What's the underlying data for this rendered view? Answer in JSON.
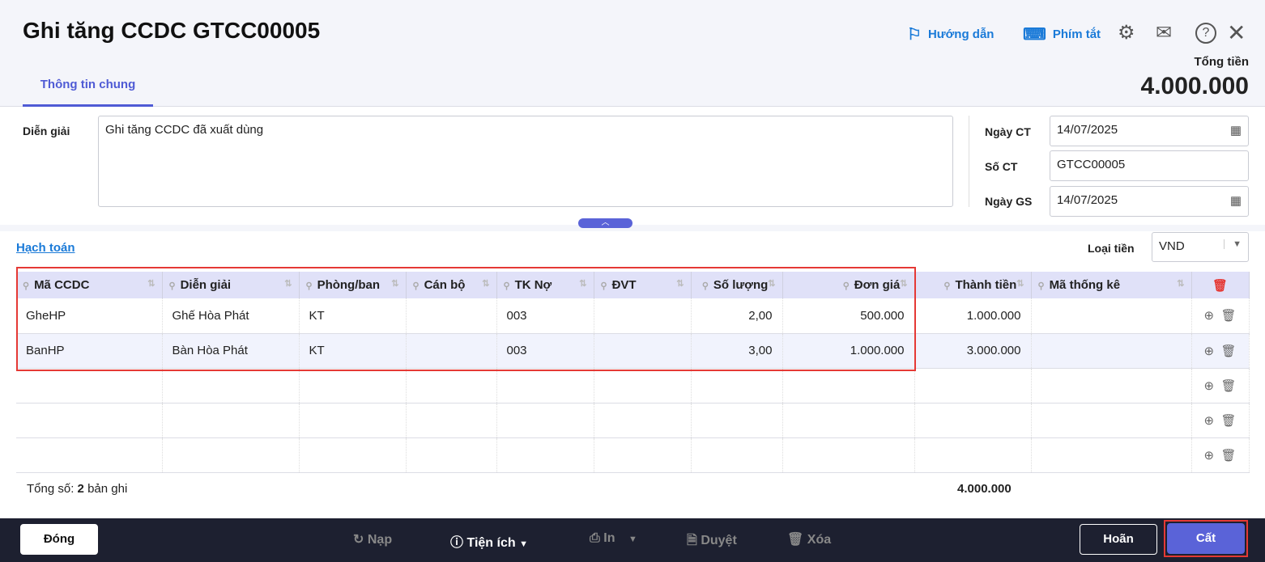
{
  "header": {
    "title": "Ghi tăng CCDC GTCC00005",
    "guide": "Hướng dẫn",
    "shortcuts": "Phím tắt",
    "total_label": "Tổng tiền",
    "total_value": "4.000.000"
  },
  "tabs": [
    {
      "label": "Thông tin chung",
      "active": true
    }
  ],
  "form": {
    "description_label": "Diễn giải",
    "description": "Ghi tăng CCDC đã xuất dùng",
    "date_ct_label": "Ngày CT",
    "date_ct": "14/07/2025",
    "so_ct_label": "Số CT",
    "so_ct": "GTCC00005",
    "date_gs_label": "Ngày GS",
    "date_gs": "14/07/2025"
  },
  "grid": {
    "link": "Hạch toán",
    "currency_label": "Loại tiền",
    "currency": "VND",
    "columns": [
      "Mã CCDC",
      "Diễn giải",
      "Phòng/ban",
      "Cán bộ",
      "TK Nợ",
      "ĐVT",
      "Số lượng",
      "Đơn giá",
      "Thành tiền",
      "Mã thống kê"
    ],
    "rows": [
      [
        "GheHP",
        "Ghế Hòa Phát",
        "KT",
        "",
        "003",
        "",
        "2,00",
        "500.000",
        "1.000.000",
        ""
      ],
      [
        "BanHP",
        "Bàn Hòa Phát",
        "KT",
        "",
        "003",
        "",
        "3,00",
        "1.000.000",
        "3.000.000",
        ""
      ]
    ],
    "footer_prefix": "Tổng số:",
    "footer_count": "2",
    "footer_suffix": "bản ghi",
    "footer_total": "4.000.000"
  },
  "toolbar": {
    "close": "Đóng",
    "reload": "Nạp",
    "utilities": "Tiện ích",
    "print": "In",
    "approve": "Duyệt",
    "delete": "Xóa",
    "cancel": "Hoãn",
    "save": "Cất"
  },
  "colors": {
    "accent": "#4f5bd5",
    "link": "#1a7ad8",
    "highlight": "#e53935",
    "bottom_bar": "#1d2030"
  }
}
